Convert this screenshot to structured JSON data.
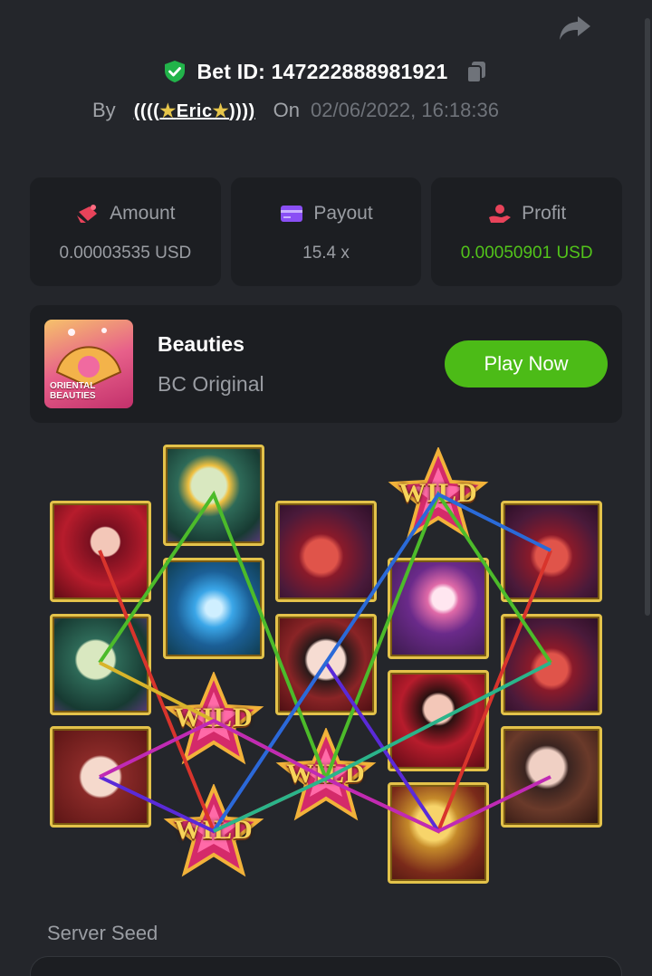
{
  "bet": {
    "label": "Bet ID:",
    "id": "147222888981921",
    "by_label": "By",
    "user_prefix": "((((",
    "user_star": "★",
    "user_name": "Eric",
    "user_suffix": "))))",
    "on_label": "On",
    "datetime": "02/06/2022, 16:18:36"
  },
  "stats": [
    {
      "label": "Amount",
      "value": "0.00003535 USD",
      "icon": "amount-icon",
      "color": "#9a9da3"
    },
    {
      "label": "Payout",
      "value": "15.4 x",
      "icon": "payout-icon",
      "color": "#9a9da3"
    },
    {
      "label": "Profit",
      "value": "0.00050901 USD",
      "icon": "profit-icon",
      "color": "#52c41a"
    }
  ],
  "game": {
    "thumb_line1": "ORIENTAL",
    "thumb_line2": "BEAUTIES",
    "title": "Beauties",
    "provider": "BC Original",
    "play_label": "Play Now"
  },
  "reels": {
    "wild_text": "WILD",
    "symbols": [
      [
        "beauty-red",
        "fan",
        "beauty-white"
      ],
      [
        "fan",
        "lotus-blue",
        "wild",
        "wild"
      ],
      [
        "pipa",
        "beauty-pale",
        "wild"
      ],
      [
        "wild",
        "ring",
        "beauty-red",
        "comb"
      ],
      [
        "pipa",
        "pipa",
        "beauty-dark"
      ]
    ]
  },
  "colors": {
    "accent_green": "#4cbb17",
    "profit_green": "#52c41a",
    "tile_border": "#e3c24a"
  },
  "server_seed": {
    "label": "Server Seed"
  }
}
